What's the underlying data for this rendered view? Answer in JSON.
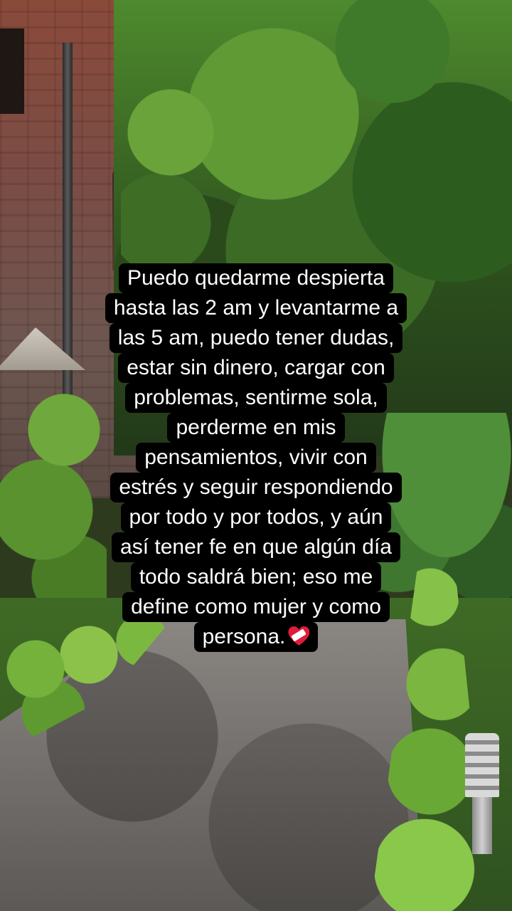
{
  "caption": {
    "lines": [
      "Puedo quedarme despierta",
      "hasta las 2 am y levantarme a",
      "las 5 am, puedo tener dudas,",
      "estar sin dinero, cargar con",
      "problemas, sentirme sola,",
      "perderme en mis",
      "pensamientos, vivir con",
      "estrés y seguir respondiendo",
      "por todo y por todos, y aún",
      "así tener fe en que algún día",
      "todo saldrá bien; eso me",
      "define como mujer y como",
      "persona."
    ],
    "emoji": "mending-heart-icon",
    "text_color": "#ffffff",
    "background_color": "#000000"
  }
}
